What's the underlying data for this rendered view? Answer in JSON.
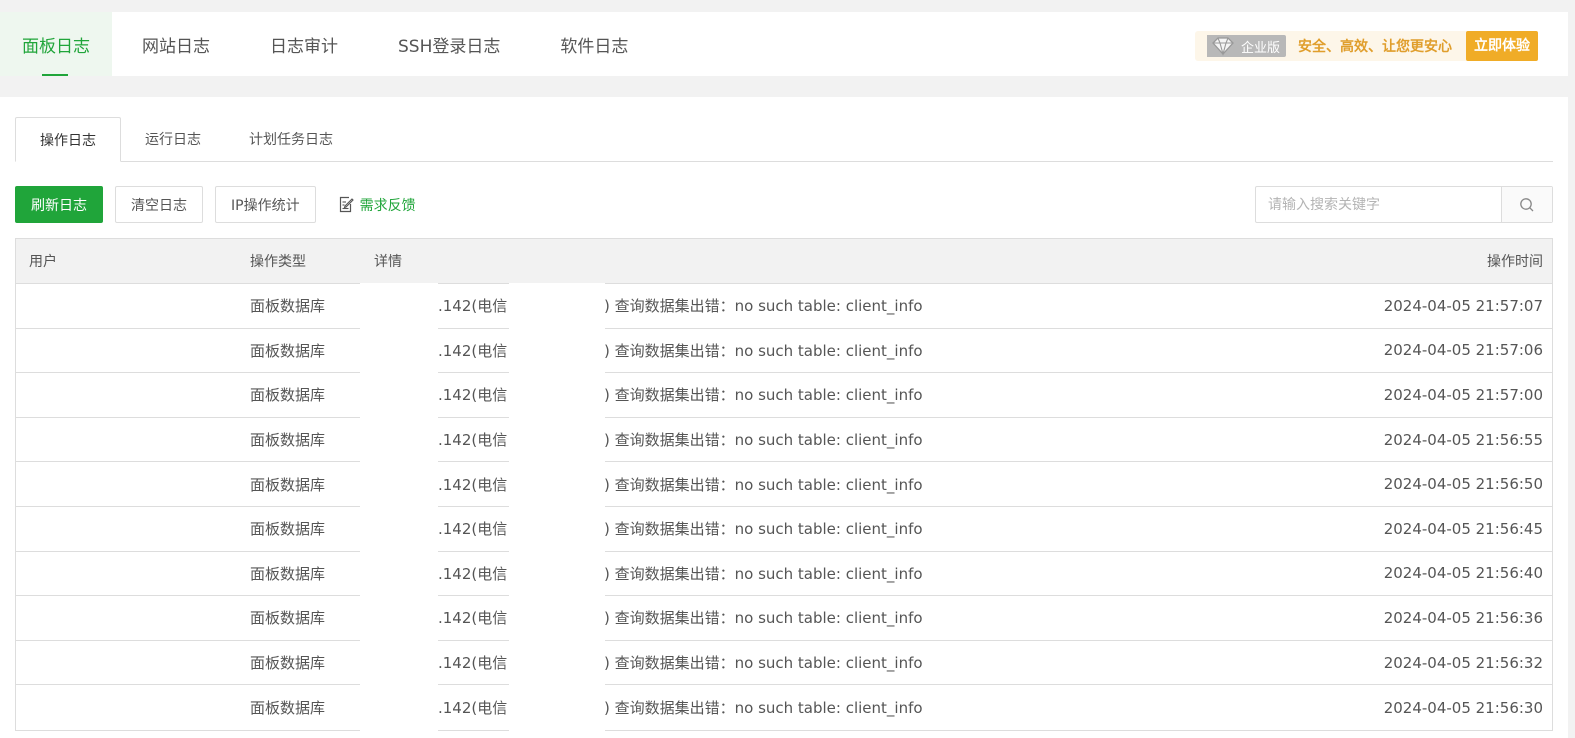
{
  "topnav": {
    "items": [
      {
        "label": "面板日志",
        "active": true
      },
      {
        "label": "网站日志",
        "active": false
      },
      {
        "label": "日志审计",
        "active": false
      },
      {
        "label": "SSH登录日志",
        "active": false
      },
      {
        "label": "软件日志",
        "active": false
      }
    ],
    "promo": {
      "badge": "企业版",
      "slogan": "安全、高效、让您更安心",
      "button": "立即体验"
    }
  },
  "subtabs": [
    {
      "label": "操作日志",
      "active": true
    },
    {
      "label": "运行日志",
      "active": false
    },
    {
      "label": "计划任务日志",
      "active": false
    }
  ],
  "toolbar": {
    "refresh": "刷新日志",
    "clear": "清空日志",
    "ip_stats": "IP操作统计",
    "feedback": "需求反馈",
    "search_placeholder": "请输入搜索关键字"
  },
  "table": {
    "headers": {
      "user": "用户",
      "type": "操作类型",
      "detail": "详情",
      "time": "操作时间"
    },
    "rows": [
      {
        "type": "面板数据库",
        "ip": ".142(电信",
        "msg": ") 查询数据集出错：no such table: client_info",
        "time": "2024-04-05 21:57:07"
      },
      {
        "type": "面板数据库",
        "ip": ".142(电信",
        "msg": ") 查询数据集出错：no such table: client_info",
        "time": "2024-04-05 21:57:06"
      },
      {
        "type": "面板数据库",
        "ip": ".142(电信",
        "msg": ") 查询数据集出错：no such table: client_info",
        "time": "2024-04-05 21:57:00"
      },
      {
        "type": "面板数据库",
        "ip": ".142(电信",
        "msg": ") 查询数据集出错：no such table: client_info",
        "time": "2024-04-05 21:56:55"
      },
      {
        "type": "面板数据库",
        "ip": ".142(电信",
        "msg": ") 查询数据集出错：no such table: client_info",
        "time": "2024-04-05 21:56:50"
      },
      {
        "type": "面板数据库",
        "ip": ".142(电信",
        "msg": ") 查询数据集出错：no such table: client_info",
        "time": "2024-04-05 21:56:45"
      },
      {
        "type": "面板数据库",
        "ip": ".142(电信",
        "msg": ") 查询数据集出错：no such table: client_info",
        "time": "2024-04-05 21:56:40"
      },
      {
        "type": "面板数据库",
        "ip": ".142(电信",
        "msg": ") 查询数据集出错：no such table: client_info",
        "time": "2024-04-05 21:56:36"
      },
      {
        "type": "面板数据库",
        "ip": ".142(电信",
        "msg": ") 查询数据集出错：no such table: client_info",
        "time": "2024-04-05 21:56:32"
      },
      {
        "type": "面板数据库",
        "ip": ".142(电信",
        "msg": ") 查询数据集出错：no such table: client_info",
        "time": "2024-04-05 21:56:30"
      }
    ]
  }
}
